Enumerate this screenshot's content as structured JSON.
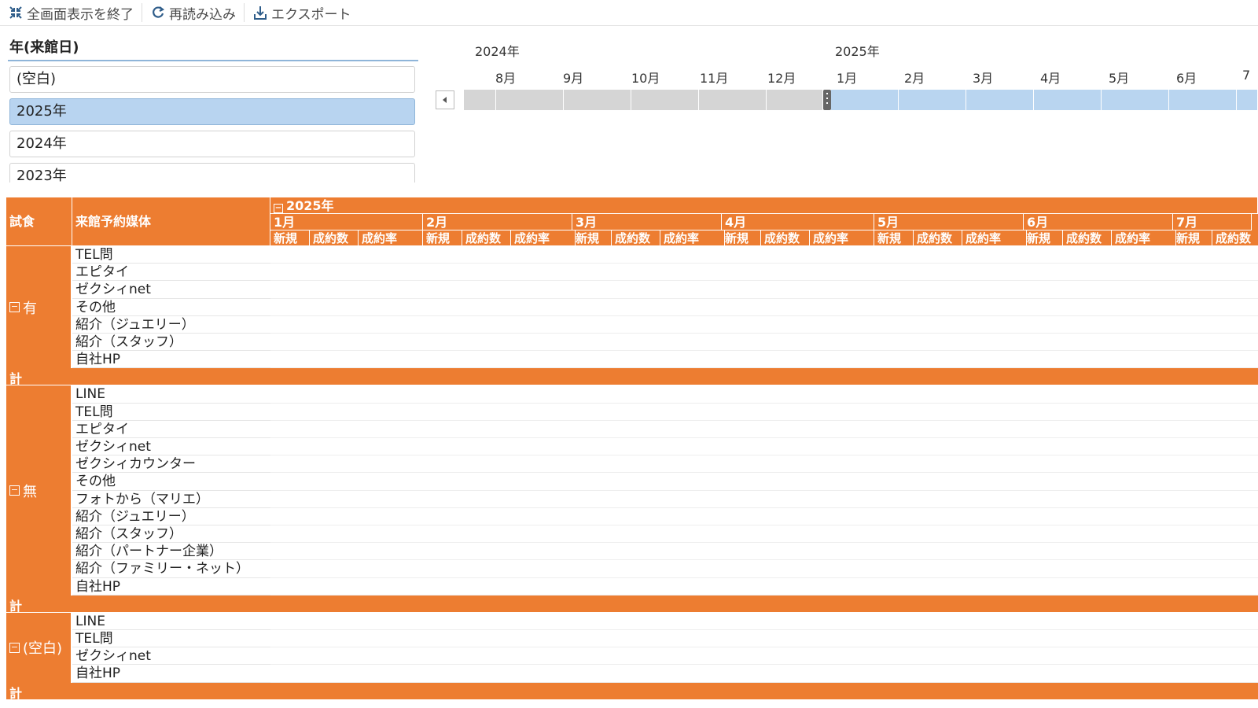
{
  "toolbar": {
    "exit_fullscreen": "全画面表示を終了",
    "reload": "再読み込み",
    "export": "エクスポート"
  },
  "slicer": {
    "title": "年(来館日)",
    "items": [
      "(空白)",
      "2025年",
      "2024年",
      "2023年"
    ],
    "selected": "2025年"
  },
  "timeline": {
    "years": [
      "2024年",
      "2025年"
    ],
    "months": [
      "8月",
      "9月",
      "10月",
      "11月",
      "12月",
      "1月",
      "2月",
      "3月",
      "4月",
      "5月",
      "6月",
      "7"
    ],
    "selected_from": "1月"
  },
  "pivot": {
    "col1_header": "試食",
    "col2_header": "来館予約媒体",
    "year_header": "2025年",
    "months": [
      "1月",
      "2月",
      "3月",
      "4月",
      "5月",
      "6月",
      "7月"
    ],
    "measures": [
      "新規",
      "成約数",
      "成約率"
    ],
    "groups": [
      {
        "label": "有",
        "rows": [
          "TEL問",
          "エピタイ",
          "ゼクシィnet",
          "その他",
          "紹介（ジュエリー）",
          "紹介（スタッフ）",
          "自社HP"
        ]
      },
      {
        "label": "無",
        "rows": [
          "LINE",
          "TEL問",
          "エピタイ",
          "ゼクシィnet",
          "ゼクシィカウンター",
          "その他",
          "フォトから（マリエ）",
          "紹介（ジュエリー）",
          "紹介（スタッフ）",
          "紹介（パートナー企業）",
          "紹介（ファミリー・ネット）",
          "自社HP"
        ]
      },
      {
        "label": "(空白)",
        "rows": [
          "LINE",
          "TEL問",
          "ゼクシィnet",
          "自社HP"
        ]
      }
    ],
    "total_label": "計"
  },
  "colors": {
    "accent": "#ed7d31",
    "selection": "#b8d4f0"
  }
}
